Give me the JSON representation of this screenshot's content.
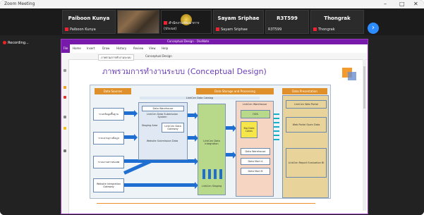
{
  "window": {
    "title": "Zoom Meeting"
  },
  "participants": [
    {
      "name": "Paiboon Kunya",
      "label": "Paiboon Kunya",
      "muted": true
    },
    {
      "name": "",
      "label": "",
      "muted": false,
      "video": true
    },
    {
      "name": "",
      "label": "สำนักงานพัฒนาการ (ประมง)",
      "muted": true,
      "logo": true
    },
    {
      "name": "Sayam Sriphae",
      "label": "Sayam Sriphae",
      "muted": true
    },
    {
      "name": "R3T599",
      "label": "R3T599",
      "muted": false
    },
    {
      "name": "Thongrak",
      "label": "Thongrak",
      "muted": true
    }
  ],
  "recording": {
    "label": "Recording..."
  },
  "onenote": {
    "window_title": "Conceptual Design - OneNote",
    "file_tab": "File",
    "ribbon_tabs": [
      "Home",
      "Insert",
      "Draw",
      "History",
      "Review",
      "View",
      "Help"
    ],
    "page_tabs": [
      "ภาพรวมการทำงานระบบ",
      "Conceptual Design"
    ]
  },
  "slide": {
    "title": "ภาพรวมการทำงานระบบ  (Conceptual Design)"
  },
  "diagram": {
    "headers": [
      "Data Sources",
      "Data Storage and Processing",
      "Data Presentation"
    ],
    "subheader": "LinkCen Data Catalog",
    "sources": [
      "ระบบข้อมูลพื้นฐาน",
      "ระบบงานฐานข้อมูล",
      "ระบบงานสารสนเทศ",
      "Website Integration Gateway"
    ],
    "catalog_items": [
      "Data Warehouse",
      "LinkCen Data Submission System",
      "Staging Area",
      "LinkCen Data Gateway",
      "Website Submission Data"
    ],
    "integration": [
      "LinkCen Data Integration",
      "LinkCen Staging"
    ],
    "warehouse": {
      "title": "LinkCen Warehouse",
      "items": [
        "ODS",
        "Big Data Lakes",
        "Data Warehouse",
        "Data Mart A",
        "Data Mart B"
      ]
    },
    "presentation": [
      "LinkCen Web Portal",
      "Web Portal Open Data",
      "LinkCen Report Evaluation BI"
    ]
  },
  "colors": {
    "zoom_blue": "#2d8cff",
    "onenote_purple": "#7719aa",
    "title_purple": "#6a3eb7",
    "accent_orange": "#e0902a",
    "arrow_blue": "#1f6fd3"
  }
}
